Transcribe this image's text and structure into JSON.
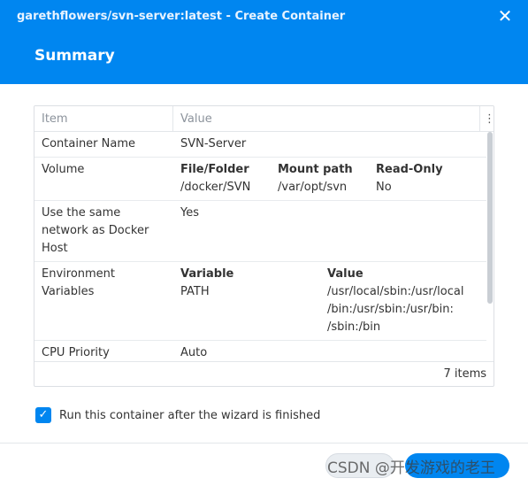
{
  "window": {
    "title": "garethflowers/svn-server:latest - Create Container",
    "step_title": "Summary"
  },
  "grid": {
    "headers": {
      "item": "Item",
      "value": "Value"
    },
    "rows": {
      "container_name": {
        "item": "Container Name",
        "value": "SVN-Server"
      },
      "volume": {
        "item": "Volume",
        "col1_header": "File/Folder",
        "col1_value": "/docker/SVN",
        "col2_header": "Mount path",
        "col2_value": "/var/opt/svn",
        "col3_header": "Read-Only",
        "col3_value": "No"
      },
      "network": {
        "item": "Use the same network as Docker Host",
        "value": "Yes"
      },
      "env": {
        "item": "Environment Variables",
        "col1_header": "Variable",
        "col1_value": "PATH",
        "col2_header": "Value",
        "col2_value": "/usr/local/sbin:/usr/local /bin:/usr/sbin:/usr/bin: /sbin:/bin"
      },
      "cpu": {
        "item": "CPU Priority",
        "value": "Auto"
      }
    },
    "item_count": "7 items"
  },
  "checkbox": {
    "label": "Run this container after the wizard is finished"
  },
  "watermark": "CSDN @开发游戏的老王",
  "colors": {
    "accent": "#0086f0",
    "header_text": "#ffffff"
  },
  "icons": {
    "close": "close-icon",
    "menu": "more-vertical-icon",
    "check": "checkmark-icon"
  }
}
